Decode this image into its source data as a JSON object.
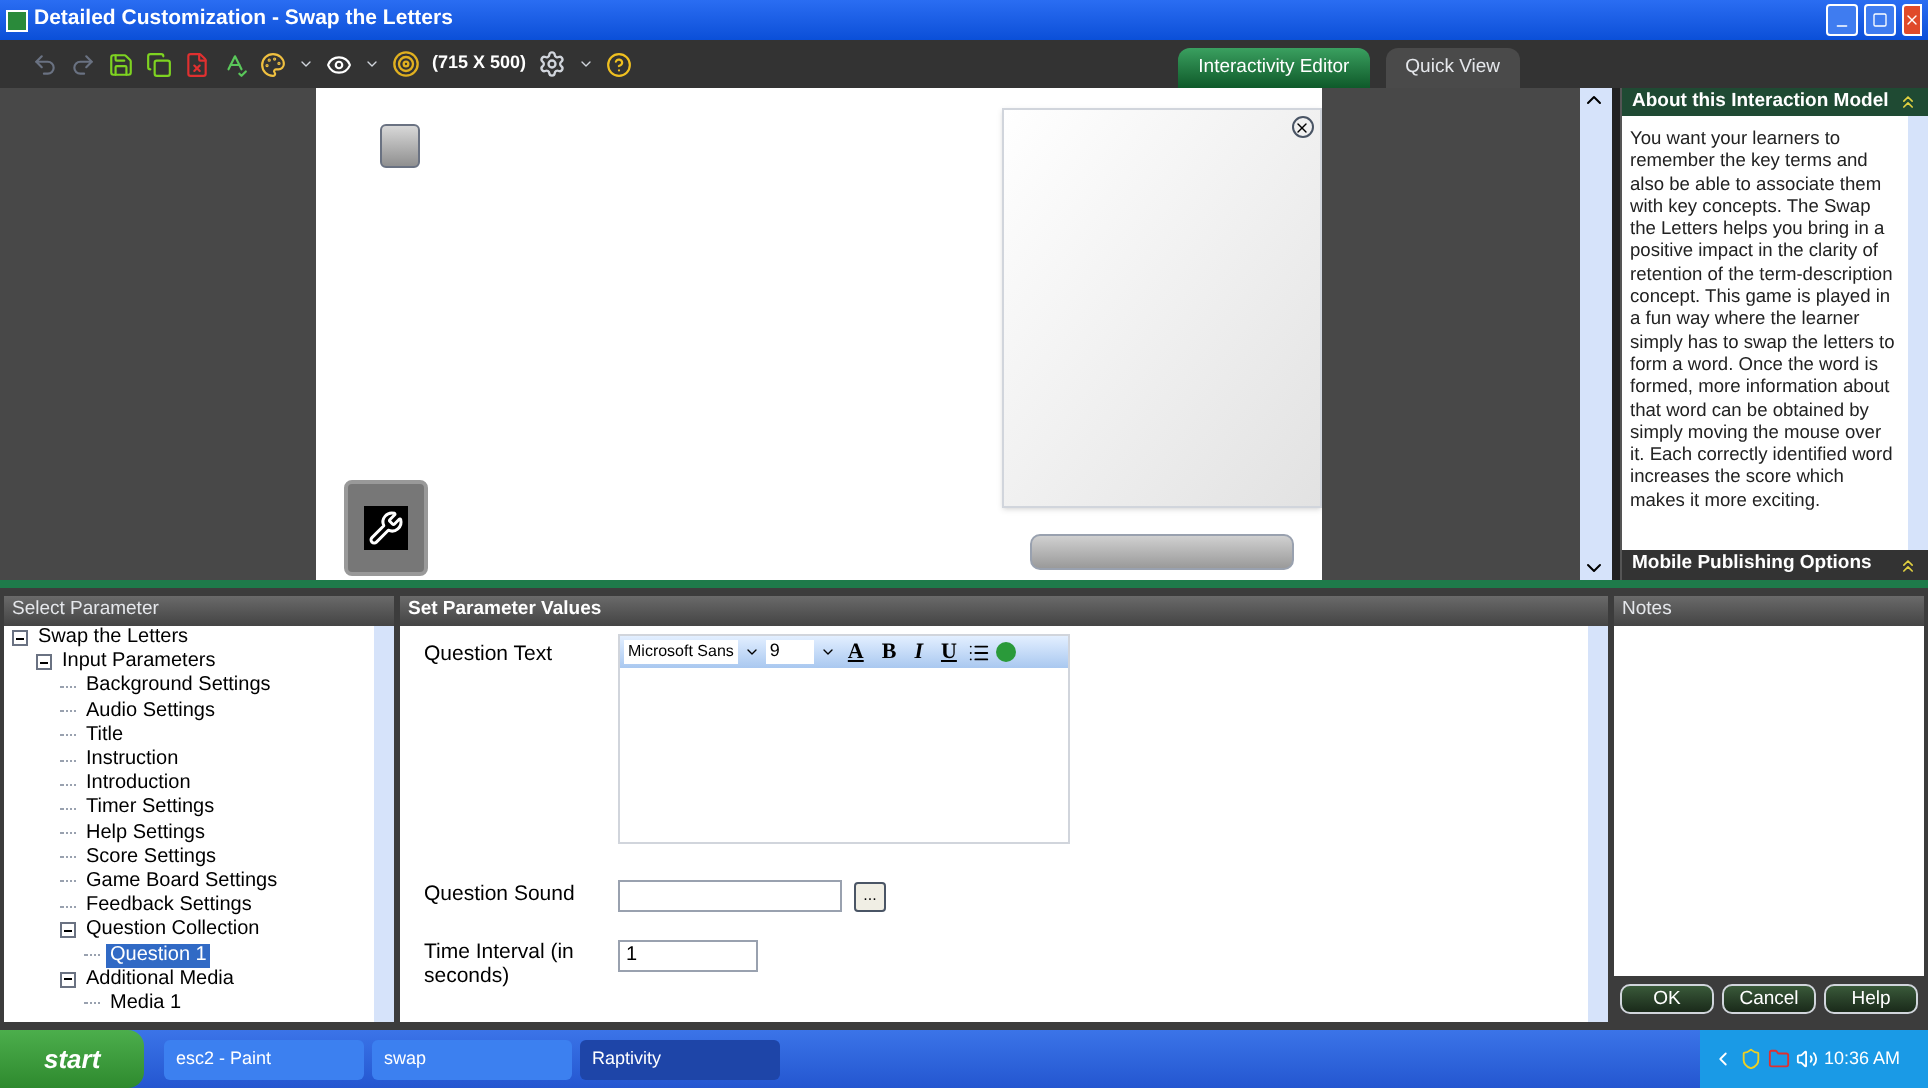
{
  "window": {
    "title": "Detailed Customization - Swap the Letters"
  },
  "toolbar": {
    "canvas_size": "(715 X 500)"
  },
  "tabs": [
    {
      "label": "Interactivity Editor",
      "selected": true
    },
    {
      "label": "Quick View",
      "selected": false
    }
  ],
  "about_panel": {
    "title": "About this Interaction Model",
    "text": "You want your learners to remember the key terms and also be able to associate them with key concepts. The Swap the Letters helps you bring in a positive impact in the clarity of retention of the term-description concept. This game is played in a fun way where the learner simply has to swap the letters to form a word. Once the word is formed, more information about that word can be obtained by simply moving the mouse over it. Each correctly identified word increases the score which makes it more exciting."
  },
  "mobile_panel": {
    "title": "Mobile Publishing Options"
  },
  "select_parameter": {
    "title": "Select Parameter",
    "tree": [
      {
        "label": "Swap the Letters",
        "expanded": true,
        "selected": false,
        "children": [
          {
            "label": "Input Parameters",
            "expanded": true,
            "selected": false,
            "children": [
              {
                "label": "Background Settings",
                "selected": false
              },
              {
                "label": "Audio Settings",
                "selected": false
              },
              {
                "label": "Title",
                "selected": false
              },
              {
                "label": "Instruction",
                "selected": false
              },
              {
                "label": "Introduction",
                "selected": false
              },
              {
                "label": "Timer Settings",
                "selected": false
              },
              {
                "label": "Help Settings",
                "selected": false
              },
              {
                "label": "Score Settings",
                "selected": false
              },
              {
                "label": "Game Board Settings",
                "selected": false
              },
              {
                "label": "Feedback Settings",
                "selected": false
              },
              {
                "label": "Question Collection",
                "expanded": true,
                "selected": false,
                "children": [
                  {
                    "label": "Question 1",
                    "selected": true
                  }
                ]
              },
              {
                "label": "Additional Media",
                "expanded": true,
                "selected": false,
                "children": [
                  {
                    "label": "Media 1",
                    "selected": false
                  }
                ]
              }
            ]
          }
        ]
      }
    ]
  },
  "set_parameter": {
    "title": "Set Parameter Values",
    "fields": [
      {
        "kind": "rich_text",
        "label": "Question Text",
        "font": "Microsoft Sans",
        "size": "9",
        "format_buttons": [
          "A",
          "B",
          "I",
          "U"
        ]
      },
      {
        "kind": "file",
        "label": "Question Sound",
        "browse": "..."
      },
      {
        "kind": "text",
        "label": "Time Interval (in seconds)",
        "value": "1"
      }
    ]
  },
  "notes": {
    "title": "Notes"
  },
  "buttons": [
    "OK",
    "Cancel",
    "Help"
  ],
  "taskbar": {
    "start": "start",
    "tasks": [
      {
        "label": "esc2 - Paint",
        "selected": false
      },
      {
        "label": "swap",
        "selected": false
      },
      {
        "label": "Raptivity",
        "selected": true
      }
    ],
    "clock": "10:36 AM"
  }
}
